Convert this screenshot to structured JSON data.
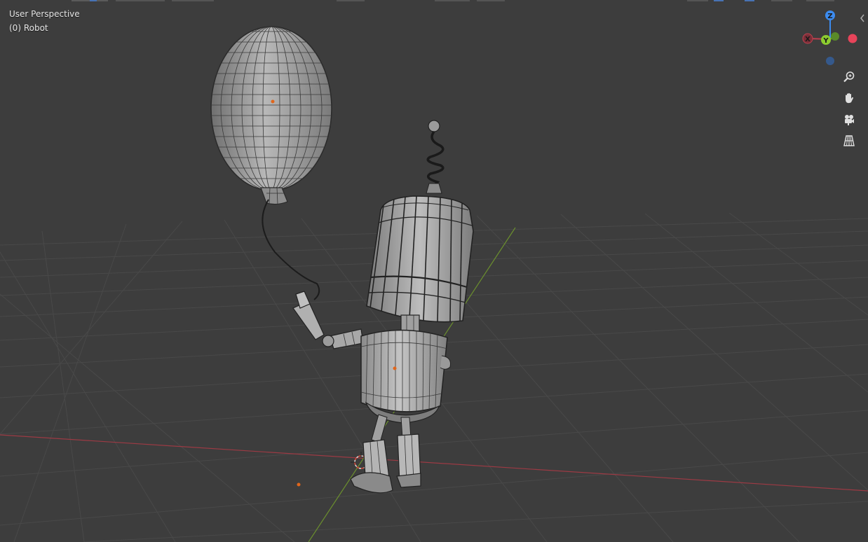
{
  "viewport": {
    "view_name": "User Perspective",
    "object_label": "(0) Robot",
    "background": "#3d3d3d"
  },
  "gizmo": {
    "axis_z": "Z",
    "axis_y": "Y",
    "axis_x": "X",
    "colors": {
      "x": "#e8445a",
      "y": "#8ccc2f",
      "z": "#3c8cf0"
    }
  },
  "nav_controls": [
    {
      "name": "zoom-icon"
    },
    {
      "name": "pan-hand-icon"
    },
    {
      "name": "camera-view-icon"
    },
    {
      "name": "orthographic-grid-icon"
    }
  ]
}
